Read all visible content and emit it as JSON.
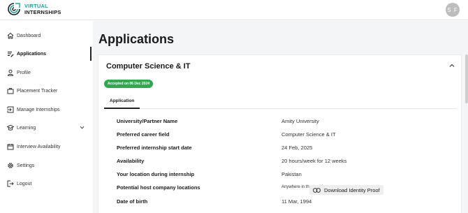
{
  "brand": {
    "line1": "VIRTUAL",
    "line2": "INTERNSHIPS"
  },
  "user": {
    "initials": "S F"
  },
  "sidebar": {
    "items": [
      {
        "label": "Dashboard",
        "icon": "home-icon"
      },
      {
        "label": "Applications",
        "icon": "list-edit-icon",
        "active": true
      },
      {
        "label": "Profile",
        "icon": "person-icon"
      },
      {
        "label": "Placement Tracker",
        "icon": "briefcase-icon"
      },
      {
        "label": "Manage Internships",
        "icon": "login-icon"
      },
      {
        "label": "Learning",
        "icon": "graduation-cap-icon",
        "expandable": true
      },
      {
        "label": "Interview Availability",
        "icon": "calendar-icon"
      },
      {
        "label": "Settings",
        "icon": "gear-icon"
      },
      {
        "label": "Logout",
        "icon": "logout-icon"
      }
    ]
  },
  "page": {
    "title": "Applications"
  },
  "application": {
    "title": "Computer Science & IT",
    "status": "Accepted on 06 Dec 2024",
    "tab": "Application",
    "fields": [
      {
        "label": "University/Partner Name",
        "value": "Amity University"
      },
      {
        "label": "Preferred career field",
        "value": "Computer Science & IT"
      },
      {
        "label": "Preferred internship start date",
        "value": "24 Feb, 2025"
      },
      {
        "label": "Availability",
        "value": "20 hours/week for 12 weeks"
      },
      {
        "label": "Your location during internship",
        "value": "Pakistan"
      },
      {
        "label": "Potential host company locations",
        "value": "Anywhere in the world"
      },
      {
        "label": "Date of birth",
        "value": "11 Mar, 1994"
      }
    ],
    "download_label": "Download Identity Proof"
  },
  "colors": {
    "accent": "#18a8a0",
    "badge": "#2fa84f",
    "active_indicator": "#222222"
  }
}
